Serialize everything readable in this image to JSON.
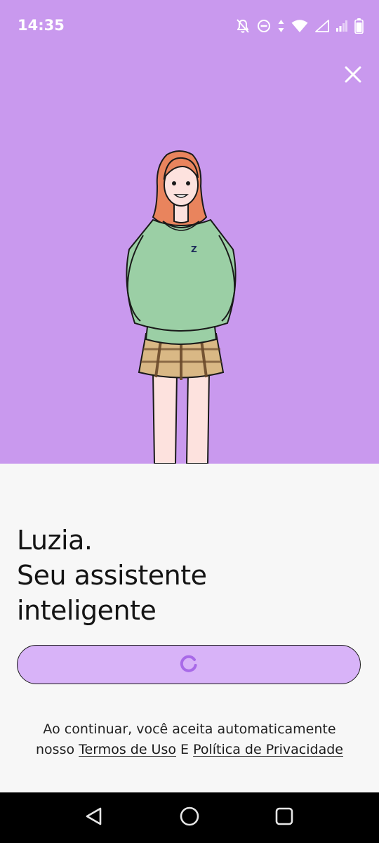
{
  "status_bar": {
    "time": "14:35",
    "icons": [
      "bell-off-icon",
      "do-not-disturb-icon",
      "data-arrows-icon",
      "wifi-icon",
      "signal-icon",
      "signal-weak-icon",
      "battery-icon"
    ]
  },
  "hero": {
    "background_color": "#c999ee",
    "close_icon": "close-icon",
    "sweater_logo": "Z"
  },
  "content": {
    "headline_line1": "Luzia.",
    "headline_line2": "Seu assistente",
    "headline_line3": "inteligente",
    "button_color": "#d8b3f8",
    "button_state_icon": "loading-spinner-icon",
    "terms_line1": "Ao continuar, você aceita automaticamente",
    "terms_prefix": "nosso",
    "terms_link": "Termos de Uso",
    "terms_conjunction": "E",
    "privacy_link": "Política de Privacidade"
  },
  "nav_bar": {
    "back": "back-icon",
    "home": "home-icon",
    "recents": "recents-icon"
  }
}
